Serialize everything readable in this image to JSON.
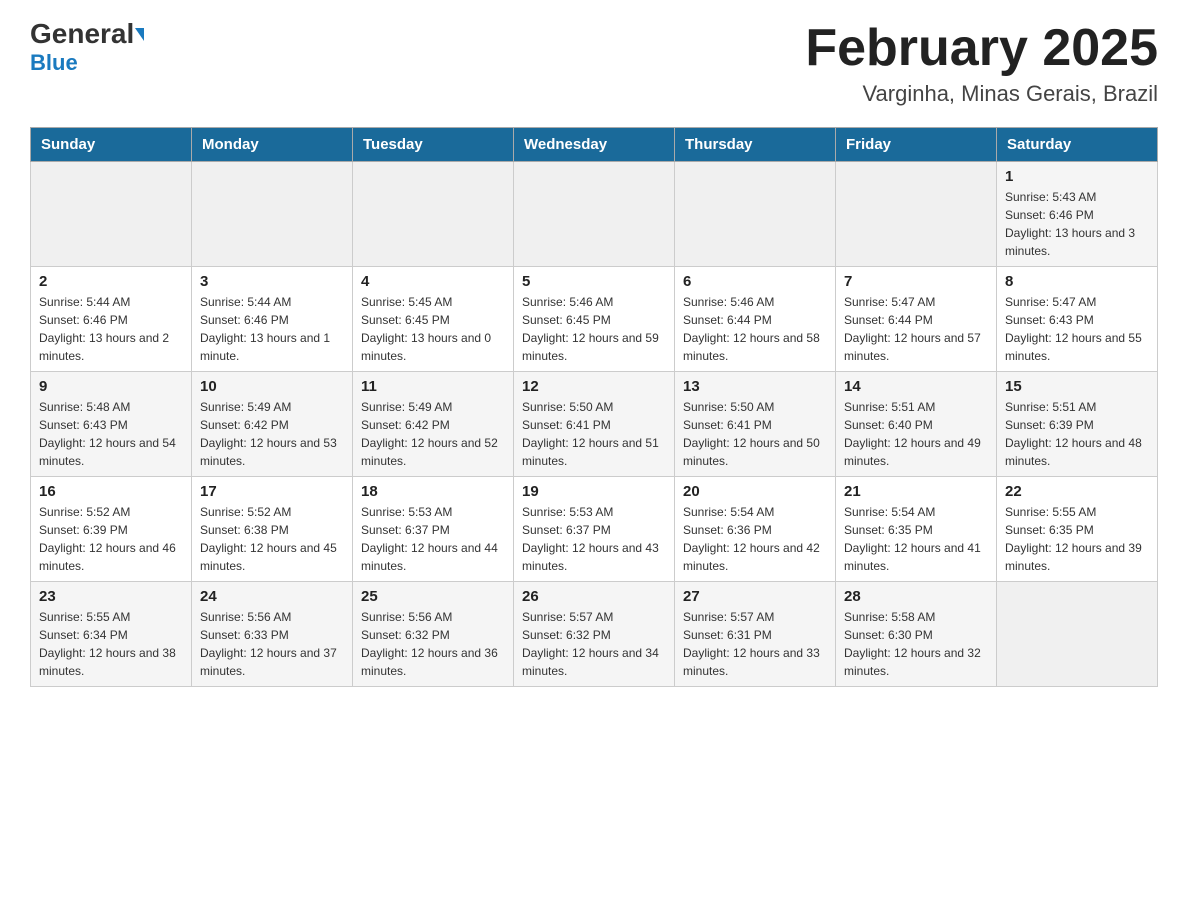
{
  "header": {
    "logo_general": "General",
    "logo_blue": "Blue",
    "title": "February 2025",
    "subtitle": "Varginha, Minas Gerais, Brazil"
  },
  "days_of_week": [
    "Sunday",
    "Monday",
    "Tuesday",
    "Wednesday",
    "Thursday",
    "Friday",
    "Saturday"
  ],
  "weeks": [
    [
      {
        "day": "",
        "info": ""
      },
      {
        "day": "",
        "info": ""
      },
      {
        "day": "",
        "info": ""
      },
      {
        "day": "",
        "info": ""
      },
      {
        "day": "",
        "info": ""
      },
      {
        "day": "",
        "info": ""
      },
      {
        "day": "1",
        "info": "Sunrise: 5:43 AM\nSunset: 6:46 PM\nDaylight: 13 hours and 3 minutes."
      }
    ],
    [
      {
        "day": "2",
        "info": "Sunrise: 5:44 AM\nSunset: 6:46 PM\nDaylight: 13 hours and 2 minutes."
      },
      {
        "day": "3",
        "info": "Sunrise: 5:44 AM\nSunset: 6:46 PM\nDaylight: 13 hours and 1 minute."
      },
      {
        "day": "4",
        "info": "Sunrise: 5:45 AM\nSunset: 6:45 PM\nDaylight: 13 hours and 0 minutes."
      },
      {
        "day": "5",
        "info": "Sunrise: 5:46 AM\nSunset: 6:45 PM\nDaylight: 12 hours and 59 minutes."
      },
      {
        "day": "6",
        "info": "Sunrise: 5:46 AM\nSunset: 6:44 PM\nDaylight: 12 hours and 58 minutes."
      },
      {
        "day": "7",
        "info": "Sunrise: 5:47 AM\nSunset: 6:44 PM\nDaylight: 12 hours and 57 minutes."
      },
      {
        "day": "8",
        "info": "Sunrise: 5:47 AM\nSunset: 6:43 PM\nDaylight: 12 hours and 55 minutes."
      }
    ],
    [
      {
        "day": "9",
        "info": "Sunrise: 5:48 AM\nSunset: 6:43 PM\nDaylight: 12 hours and 54 minutes."
      },
      {
        "day": "10",
        "info": "Sunrise: 5:49 AM\nSunset: 6:42 PM\nDaylight: 12 hours and 53 minutes."
      },
      {
        "day": "11",
        "info": "Sunrise: 5:49 AM\nSunset: 6:42 PM\nDaylight: 12 hours and 52 minutes."
      },
      {
        "day": "12",
        "info": "Sunrise: 5:50 AM\nSunset: 6:41 PM\nDaylight: 12 hours and 51 minutes."
      },
      {
        "day": "13",
        "info": "Sunrise: 5:50 AM\nSunset: 6:41 PM\nDaylight: 12 hours and 50 minutes."
      },
      {
        "day": "14",
        "info": "Sunrise: 5:51 AM\nSunset: 6:40 PM\nDaylight: 12 hours and 49 minutes."
      },
      {
        "day": "15",
        "info": "Sunrise: 5:51 AM\nSunset: 6:39 PM\nDaylight: 12 hours and 48 minutes."
      }
    ],
    [
      {
        "day": "16",
        "info": "Sunrise: 5:52 AM\nSunset: 6:39 PM\nDaylight: 12 hours and 46 minutes."
      },
      {
        "day": "17",
        "info": "Sunrise: 5:52 AM\nSunset: 6:38 PM\nDaylight: 12 hours and 45 minutes."
      },
      {
        "day": "18",
        "info": "Sunrise: 5:53 AM\nSunset: 6:37 PM\nDaylight: 12 hours and 44 minutes."
      },
      {
        "day": "19",
        "info": "Sunrise: 5:53 AM\nSunset: 6:37 PM\nDaylight: 12 hours and 43 minutes."
      },
      {
        "day": "20",
        "info": "Sunrise: 5:54 AM\nSunset: 6:36 PM\nDaylight: 12 hours and 42 minutes."
      },
      {
        "day": "21",
        "info": "Sunrise: 5:54 AM\nSunset: 6:35 PM\nDaylight: 12 hours and 41 minutes."
      },
      {
        "day": "22",
        "info": "Sunrise: 5:55 AM\nSunset: 6:35 PM\nDaylight: 12 hours and 39 minutes."
      }
    ],
    [
      {
        "day": "23",
        "info": "Sunrise: 5:55 AM\nSunset: 6:34 PM\nDaylight: 12 hours and 38 minutes."
      },
      {
        "day": "24",
        "info": "Sunrise: 5:56 AM\nSunset: 6:33 PM\nDaylight: 12 hours and 37 minutes."
      },
      {
        "day": "25",
        "info": "Sunrise: 5:56 AM\nSunset: 6:32 PM\nDaylight: 12 hours and 36 minutes."
      },
      {
        "day": "26",
        "info": "Sunrise: 5:57 AM\nSunset: 6:32 PM\nDaylight: 12 hours and 34 minutes."
      },
      {
        "day": "27",
        "info": "Sunrise: 5:57 AM\nSunset: 6:31 PM\nDaylight: 12 hours and 33 minutes."
      },
      {
        "day": "28",
        "info": "Sunrise: 5:58 AM\nSunset: 6:30 PM\nDaylight: 12 hours and 32 minutes."
      },
      {
        "day": "",
        "info": ""
      }
    ]
  ]
}
